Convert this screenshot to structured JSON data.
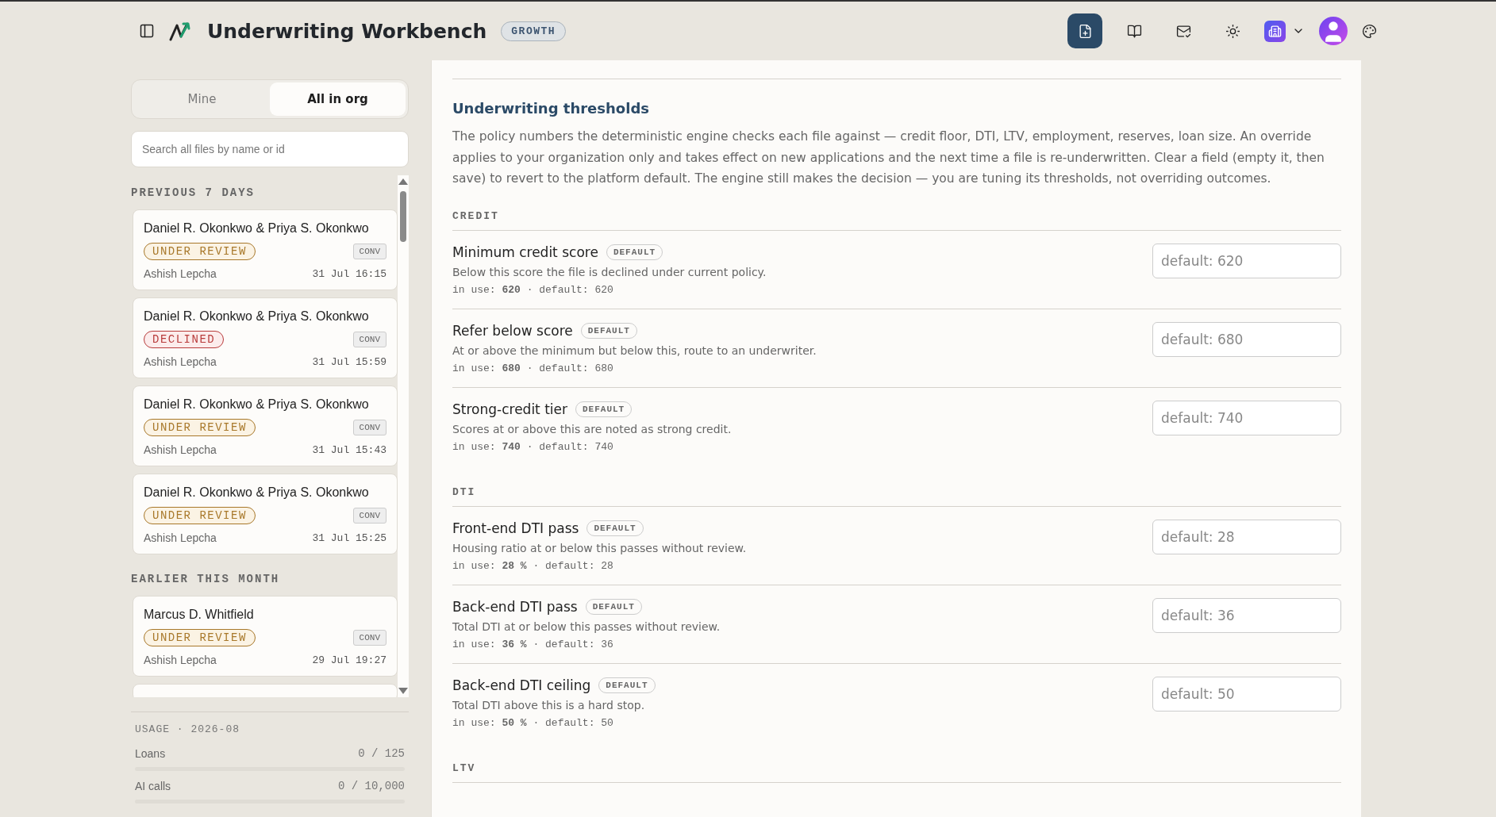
{
  "header": {
    "title": "Underwriting Workbench",
    "plan_badge": "GROWTH",
    "toolbar": [
      {
        "selected": true
      },
      {
        "selected": false
      },
      {
        "selected": false
      },
      {
        "selected": false
      }
    ]
  },
  "sidebar": {
    "tabs": [
      {
        "label": "Mine",
        "selected": false
      },
      {
        "label": "All in org",
        "selected": true
      }
    ],
    "search": {
      "placeholder": "Search all files by name or id"
    },
    "groups": [
      {
        "label": "PREVIOUS 7 DAYS",
        "files": [
          {
            "name": "Daniel R. Okonkwo & Priya S. Okonkwo",
            "status": {
              "label": "UNDER REVIEW",
              "kind": "review"
            },
            "product": "CONV",
            "owner": "Ashish Lepcha",
            "time": "31 Jul 16:15"
          },
          {
            "name": "Daniel R. Okonkwo & Priya S. Okonkwo",
            "status": {
              "label": "DECLINED",
              "kind": "declined"
            },
            "product": "CONV",
            "owner": "Ashish Lepcha",
            "time": "31 Jul 15:59"
          },
          {
            "name": "Daniel R. Okonkwo & Priya S. Okonkwo",
            "status": {
              "label": "UNDER REVIEW",
              "kind": "review"
            },
            "product": "CONV",
            "owner": "Ashish Lepcha",
            "time": "31 Jul 15:43"
          },
          {
            "name": "Daniel R. Okonkwo & Priya S. Okonkwo",
            "status": {
              "label": "UNDER REVIEW",
              "kind": "review"
            },
            "product": "CONV",
            "owner": "Ashish Lepcha",
            "time": "31 Jul 15:25"
          }
        ]
      },
      {
        "label": "EARLIER THIS MONTH",
        "files": [
          {
            "name": "Marcus D. Whitfield",
            "status": {
              "label": "UNDER REVIEW",
              "kind": "review"
            },
            "product": "CONV",
            "owner": "Ashish Lepcha",
            "time": "29 Jul 19:27"
          }
        ]
      }
    ],
    "usage": {
      "label": "USAGE · 2026-08",
      "meters": [
        {
          "name": "Loans",
          "reading": "0 / 125",
          "level": 0
        },
        {
          "name": "AI calls",
          "reading": "0 / 10,000",
          "level": 0
        }
      ]
    }
  },
  "main": {
    "title": "Underwriting thresholds",
    "description": "The policy numbers the deterministic engine checks each file against — credit floor, DTI, LTV, employment, reserves, loan size. An override applies to your organization only and takes effect on new applications and the next time a file is re-underwritten. Clear a field (empty it, then save) to revert to the platform default. The engine still makes the decision — you are tuning its thresholds, not overriding outcomes.",
    "sections": [
      {
        "label": "CREDIT",
        "settings": [
          {
            "name": "Minimum credit score",
            "badge": "DEFAULT",
            "help": "Below this score the file is declined under current policy.",
            "values": "in use: **620** · default: 620",
            "placeholder": "default: 620"
          },
          {
            "name": "Refer below score",
            "badge": "DEFAULT",
            "help": "At or above the minimum but below this, route to an underwriter.",
            "values": "in use: **680** · default: 680",
            "placeholder": "default: 680"
          },
          {
            "name": "Strong-credit tier",
            "badge": "DEFAULT",
            "help": "Scores at or above this are noted as strong credit.",
            "values": "in use: **740** · default: 740",
            "placeholder": "default: 740"
          }
        ]
      },
      {
        "label": "DTI",
        "settings": [
          {
            "name": "Front-end DTI pass",
            "badge": "DEFAULT",
            "help": "Housing ratio at or below this passes without review.",
            "values": "in use: **28 %** · default: 28",
            "placeholder": "default: 28"
          },
          {
            "name": "Back-end DTI pass",
            "badge": "DEFAULT",
            "help": "Total DTI at or below this passes without review.",
            "values": "in use: **36 %** · default: 36",
            "placeholder": "default: 36"
          },
          {
            "name": "Back-end DTI ceiling",
            "badge": "DEFAULT",
            "help": "Total DTI above this is a hard stop.",
            "values": "in use: **50 %** · default: 50",
            "placeholder": "default: 50"
          }
        ]
      },
      {
        "label": "LTV"
      }
    ]
  }
}
